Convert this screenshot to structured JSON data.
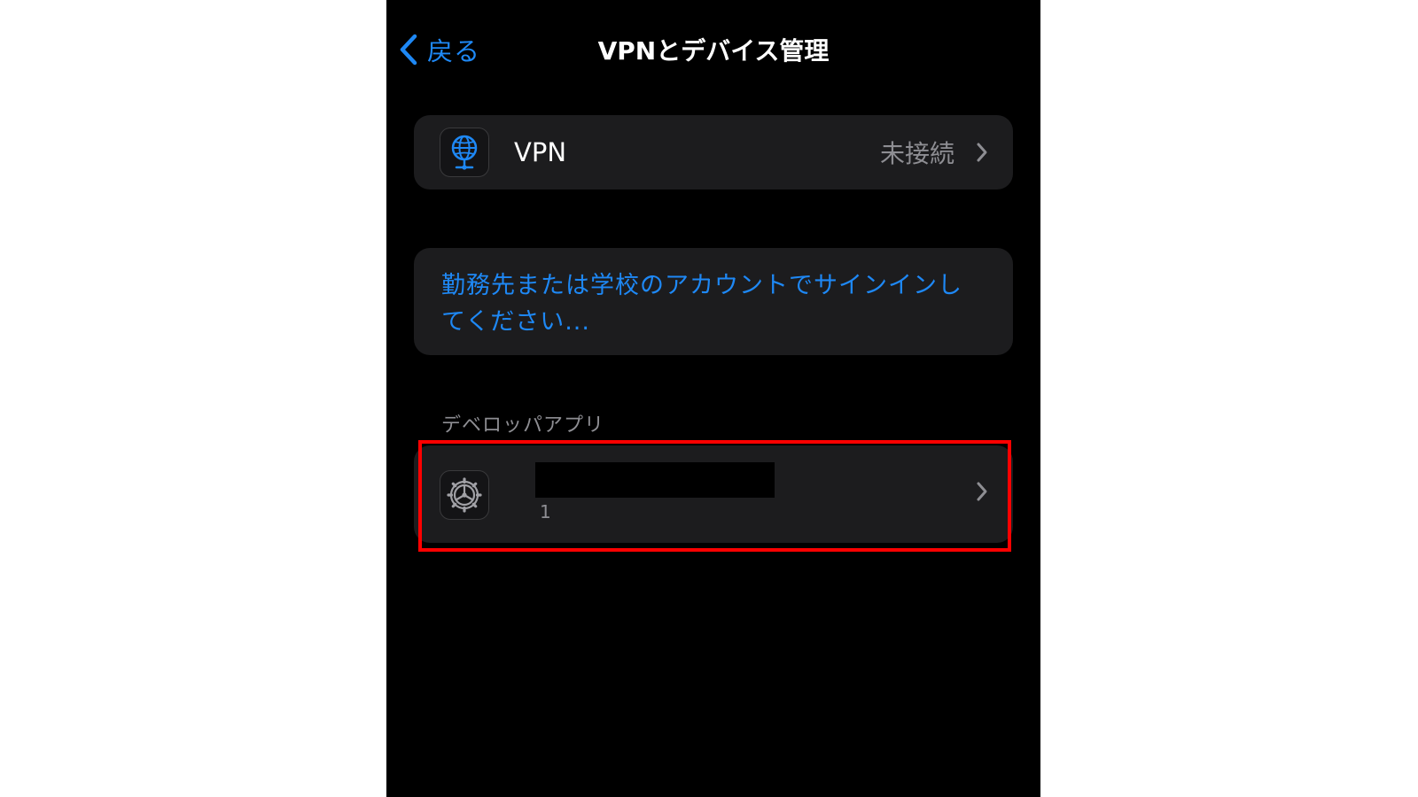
{
  "navbar": {
    "back_label": "戻る",
    "title": "VPNとデバイス管理"
  },
  "vpn_row": {
    "label": "VPN",
    "status": "未接続",
    "icon": "globe-network-icon"
  },
  "signin_row": {
    "text": "勤務先または学校のアカウントでサインインしてください..."
  },
  "developer_section": {
    "header": "デベロッパアプリ",
    "app": {
      "icon": "settings-gear-icon",
      "count": "1"
    }
  },
  "colors": {
    "accent": "#1e88f5",
    "background": "#000000",
    "card": "#1c1c1e",
    "secondary_text": "#8e8e93",
    "highlight": "#ff0000"
  }
}
